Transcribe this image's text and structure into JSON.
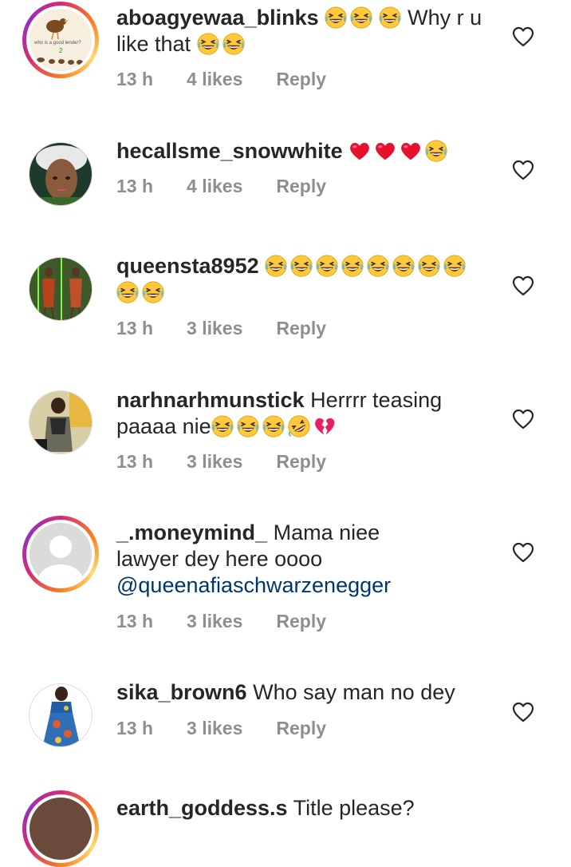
{
  "comments": [
    {
      "username": "aboagyewaa_blinks",
      "text": "Why r u like that",
      "time": "13 h",
      "likes": "4 likes",
      "reply": "Reply",
      "avatar_caption": "who is a good lender?"
    },
    {
      "username": "hecallsme_snowwhite",
      "text": "",
      "time": "13 h",
      "likes": "4 likes",
      "reply": "Reply"
    },
    {
      "username": "queensta8952",
      "text": "",
      "time": "13 h",
      "likes": "3 likes",
      "reply": "Reply"
    },
    {
      "username": "narhnarhmunstick",
      "text": "Herrrr teasing paaaa  nie",
      "time": "13 h",
      "likes": "3 likes",
      "reply": "Reply"
    },
    {
      "username": "_.moneymind_",
      "text": "Mama niee lawyer dey here oooo",
      "mention": "@queenafiaschwarzenegger",
      "time": "13 h",
      "likes": "3 likes",
      "reply": "Reply"
    },
    {
      "username": "sika_brown6",
      "text": "Who say man no dey",
      "time": "13 h",
      "likes": "3 likes",
      "reply": "Reply"
    },
    {
      "username": "earth_goddess.s",
      "text": "Title please?"
    }
  ],
  "colors": {
    "meta_text": "#8e8e8e",
    "mention": "#00376b",
    "emoji_face": "#ffc83d",
    "heart_emoji": "#e8112d"
  },
  "icons": [
    "heart-outline-icon",
    "laughing-emoji-icon",
    "red-heart-emoji-icon",
    "rofl-emoji-icon",
    "broken-heart-emoji-icon"
  ]
}
